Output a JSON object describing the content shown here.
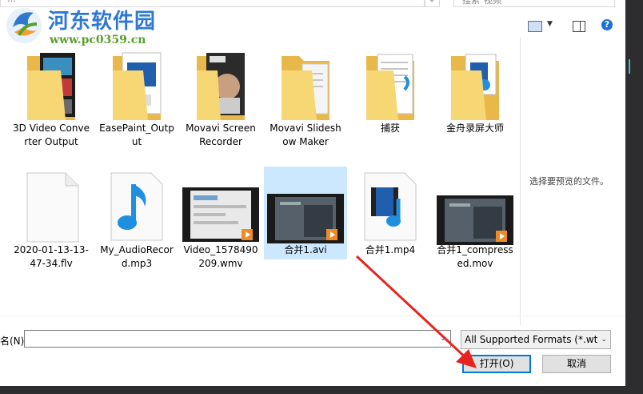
{
  "top": {
    "breadcrumb": "…",
    "search_placeholder": "搜索\"视频\""
  },
  "watermark": {
    "title": "河东软件园",
    "url": "www.pc0359.cn"
  },
  "preview": {
    "message": "选择要预览的文件。"
  },
  "files": [
    {
      "label": "3D Video Converter Output",
      "type": "folder"
    },
    {
      "label": "EasePaint_Output",
      "type": "folder"
    },
    {
      "label": "Movavi Screen Recorder",
      "type": "folder"
    },
    {
      "label": "Movavi Slideshow Maker",
      "type": "folder"
    },
    {
      "label": "捕获",
      "type": "folder"
    },
    {
      "label": "金舟录屏大师",
      "type": "folder"
    },
    {
      "label": "2020-01-13-13-47-34.flv",
      "type": "file"
    },
    {
      "label": "My_AudioRecord.mp3",
      "type": "audio"
    },
    {
      "label": "Video_1578490209.wmv",
      "type": "video"
    },
    {
      "label": "合并1.avi",
      "type": "video",
      "selected": true
    },
    {
      "label": "合并1.mp4",
      "type": "media"
    },
    {
      "label": "合并1_compressed.mov",
      "type": "video"
    }
  ],
  "bottom": {
    "filename_label": "名(N):",
    "filename_value": "",
    "filter_value": "All Supported Formats (*.wtv",
    "open_label": "打开(O)",
    "cancel_label": "取消"
  },
  "colors": {
    "accent": "#0078d7",
    "selection": "#cce8ff",
    "arrow": "#e8231f",
    "watermark_blue": "#2e78d2",
    "watermark_green": "#5aa02c"
  }
}
